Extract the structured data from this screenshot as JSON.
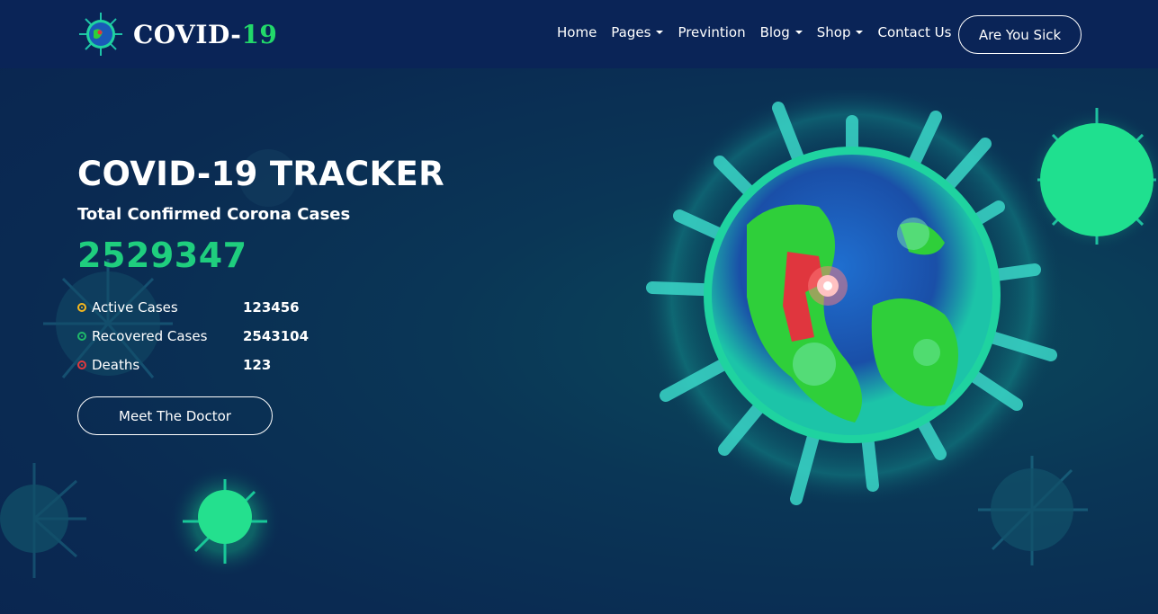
{
  "brand": {
    "name_prefix": "COVID-",
    "name_accent": "19",
    "accent_color": "#22d86a"
  },
  "nav": {
    "items": [
      {
        "label": "Home",
        "dropdown": false
      },
      {
        "label": "Pages",
        "dropdown": true
      },
      {
        "label": "Previntion",
        "dropdown": false
      },
      {
        "label": "Blog",
        "dropdown": true
      },
      {
        "label": "Shop",
        "dropdown": true
      },
      {
        "label": "Contact Us",
        "dropdown": false
      }
    ],
    "cta_label": "Are You Sick"
  },
  "hero": {
    "title": "COVID-19 TRACKER",
    "subtitle": "Total Confirmed Corona Cases",
    "total": "2529347",
    "stats": [
      {
        "label": "Active Cases",
        "value": "123456",
        "color": "#f5b81f",
        "icon": "target-icon"
      },
      {
        "label": "Recovered Cases",
        "value": "2543104",
        "color": "#1fb86a",
        "icon": "target-icon"
      },
      {
        "label": "Deaths",
        "value": "123",
        "color": "#e0393e",
        "icon": "target-icon"
      }
    ],
    "cta_label": "Meet The Doctor"
  },
  "colors": {
    "navbar": "#0a2457",
    "background": "#0a2a52",
    "count_green": "#1fce7e"
  }
}
